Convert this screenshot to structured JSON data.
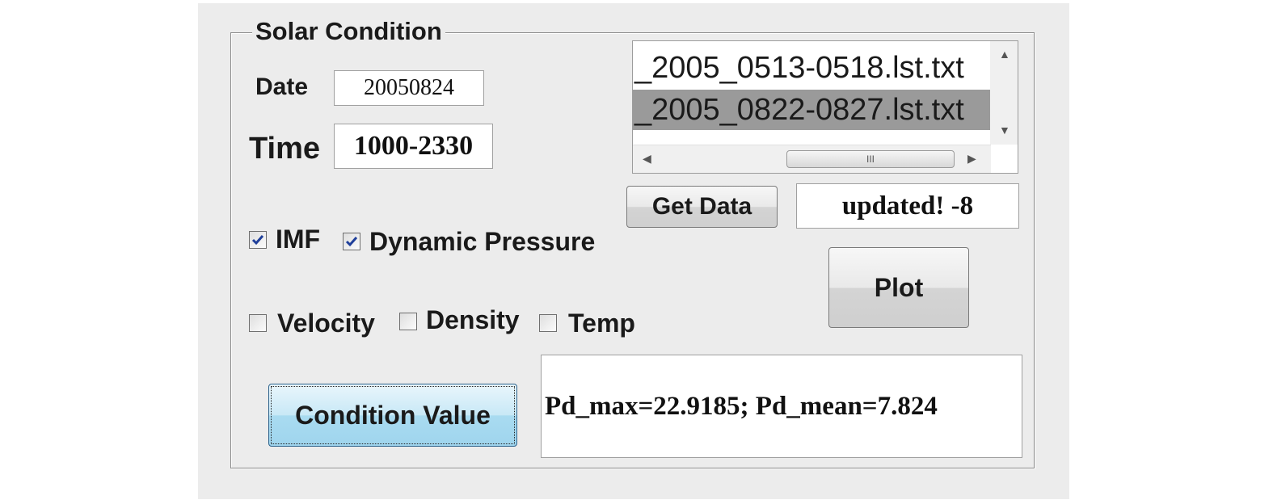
{
  "panel": {
    "title": "Solar Condition"
  },
  "date": {
    "label": "Date",
    "value": "20050824"
  },
  "time": {
    "label": "Time",
    "value": "1000-2330"
  },
  "file_list": {
    "items": [
      "_2005_0513-0518.lst.txt",
      "_2005_0822-0827.lst.txt"
    ],
    "selected_index": 1,
    "scroll_thumb_glyph": "III"
  },
  "get_data": {
    "label": "Get Data",
    "status": "updated! -8"
  },
  "plot": {
    "label": "Plot"
  },
  "checkboxes": {
    "imf": {
      "label": "IMF",
      "checked": true
    },
    "dynamic_pressure": {
      "label": "Dynamic Pressure",
      "checked": true
    },
    "velocity": {
      "label": "Velocity",
      "checked": false
    },
    "density": {
      "label": "Density",
      "checked": false
    },
    "temp": {
      "label": "Temp",
      "checked": false
    }
  },
  "condition": {
    "button_label": "Condition Value",
    "output": "Pd_max=22.9185; Pd_mean=7.824"
  },
  "colors": {
    "accent_check": "#1f3f9a",
    "selected_row": "#9a9a9a",
    "button_blue": "#a9dbf0"
  }
}
